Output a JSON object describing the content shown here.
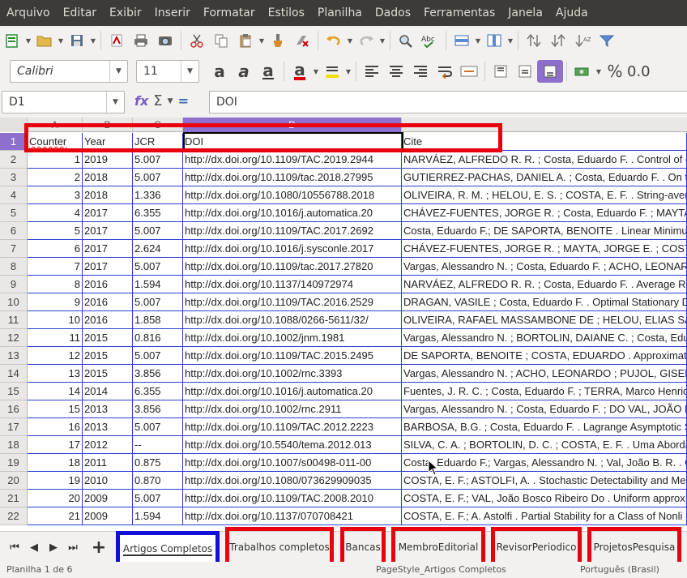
{
  "menubar": [
    "Arquivo",
    "Editar",
    "Exibir",
    "Inserir",
    "Formatar",
    "Estilos",
    "Planilha",
    "Dados",
    "Ferramentas",
    "Janela",
    "Ajuda"
  ],
  "toolbar": {
    "font_name": "Calibri",
    "font_size": "11",
    "percent_label": "%",
    "number_label": "0.0"
  },
  "formula_bar": {
    "name_box": "D1",
    "content": "DOI",
    "sum_icon": "Σ",
    "eq_icon": "="
  },
  "columns": [
    "A",
    "B",
    "C",
    "D"
  ],
  "header_row": {
    "num": "1",
    "a": "Counter",
    "b": "Year",
    "c": "JCR",
    "d": "DOI",
    "e": "Cite"
  },
  "rows": [
    {
      "num": "2",
      "a": "1",
      "b": "2019",
      "c": "5.007",
      "d": "http://dx.doi.org/10.1109/TAC.2019.2944",
      "e": "NARVÁEZ, ALFREDO R. R. ; Costa, Eduardo F. . Control of co"
    },
    {
      "num": "3",
      "a": "2",
      "b": "2018",
      "c": "5.007",
      "d": "http://dx.doi.org/10.1109/tac.2018.27995",
      "e": "GUTIERREZ-PACHAS, DANIEL A. ; Costa, Eduardo F. . On th"
    },
    {
      "num": "4",
      "a": "3",
      "b": "2018",
      "c": "1.336",
      "d": "http://dx.doi.org/10.1080/10556788.2018",
      "e": "OLIVEIRA, R. M. ; HELOU, E. S. ; COSTA, E. F. . String-average"
    },
    {
      "num": "5",
      "a": "4",
      "b": "2017",
      "c": "6.355",
      "d": "http://dx.doi.org/10.1016/j.automatica.20",
      "e": "CHÁVEZ-FUENTES, JORGE R. ; Costa, Eduardo F. ; MAYTA, J"
    },
    {
      "num": "6",
      "a": "5",
      "b": "2017",
      "c": "5.007",
      "d": "http://dx.doi.org/10.1109/TAC.2017.2692",
      "e": "Costa, Eduardo F.; DE SAPORTA, BENOITE . Linear Minimum"
    },
    {
      "num": "7",
      "a": "6",
      "b": "2017",
      "c": "2.624",
      "d": "http://dx.doi.org/10.1016/j.sysconle.2017",
      "e": "CHÁVEZ-FUENTES, JORGE R. ; MAYTA, JORGE E. ; COSTA, Ed"
    },
    {
      "num": "8",
      "a": "7",
      "b": "2017",
      "c": "5.007",
      "d": "http://dx.doi.org/10.1109/tac.2017.27820",
      "e": "Vargas, Alessandro N. ; Costa, Eduardo F. ; ACHO, LEONAR"
    },
    {
      "num": "9",
      "a": "8",
      "b": "2016",
      "c": "1.594",
      "d": "http://dx.doi.org/10.1137/140972974",
      "e": "NARVÁEZ, ALFREDO R. R. ; Costa, Eduardo F. . Average Rea"
    },
    {
      "num": "10",
      "a": "9",
      "b": "2016",
      "c": "5.007",
      "d": "http://dx.doi.org/10.1109/TAC.2016.2529",
      "e": "DRAGAN, VASILE ; Costa, Eduardo F. . Optimal Stationary D"
    },
    {
      "num": "11",
      "a": "10",
      "b": "2016",
      "c": "1.858",
      "d": "http://dx.doi.org/10.1088/0266-5611/32/",
      "e": "OLIVEIRA, RAFAEL MASSAMBONE DE ; HELOU, ELIAS SALO"
    },
    {
      "num": "12",
      "a": "11",
      "b": "2015",
      "c": "0.816",
      "d": "http://dx.doi.org/10.1002/jnm.1981",
      "e": "Vargas, Alessandro N. ; BORTOLIN, DAIANE C. ; Costa, Edu"
    },
    {
      "num": "13",
      "a": "12",
      "b": "2015",
      "c": "5.007",
      "d": "http://dx.doi.org/10.1109/TAC.2015.2495",
      "e": "DE SAPORTA, BENOITE ; COSTA, EDUARDO . Approximate K"
    },
    {
      "num": "14",
      "a": "13",
      "b": "2015",
      "c": "3.856",
      "d": "http://dx.doi.org/10.1002/rnc.3393",
      "e": "Vargas, Alessandro N. ; ACHO, LEONARDO ; PUJOL, GISELA"
    },
    {
      "num": "15",
      "a": "14",
      "b": "2014",
      "c": "6.355",
      "d": "http://dx.doi.org/10.1016/j.automatica.20",
      "e": "Fuentes, J. R. C. ; Costa, Eduardo F. ; TERRA, Marco Henriqu"
    },
    {
      "num": "16",
      "a": "15",
      "b": "2013",
      "c": "3.856",
      "d": "http://dx.doi.org/10.1002/rnc.2911",
      "e": "Vargas, Alessandro N. ; Costa, Eduardo F. ; DO VAL, JOÃO B"
    },
    {
      "num": "17",
      "a": "16",
      "b": "2013",
      "c": "5.007",
      "d": "http://dx.doi.org/10.1109/TAC.2012.2223",
      "e": "BARBOSA, B.G. ; Costa, Eduardo F. . Lagrange Asymptotic S"
    },
    {
      "num": "18",
      "a": "17",
      "b": "2012",
      "c": "--",
      "d": "http://dx.doi.org/10.5540/tema.2012.013",
      "e": "SILVA, C. A. ; BORTOLIN, D. C. ; COSTA, E. F. . Uma Aborda"
    },
    {
      "num": "19",
      "a": "18",
      "b": "2011",
      "c": "0.875",
      "d": "http://dx.doi.org/10.1007/s00498-011-00",
      "e": "Costa, Eduardo F.; Vargas, Alessandro N. ; Val, João B. R. . G"
    },
    {
      "num": "20",
      "a": "19",
      "b": "2010",
      "c": "0.870",
      "d": "http://dx.doi.org/10.1080/073629909035",
      "e": "COSTA, E. F.; ASTOLFI, A. . Stochastic Detectability and Me"
    },
    {
      "num": "21",
      "a": "20",
      "b": "2009",
      "c": "5.007",
      "d": "http://dx.doi.org/10.1109/TAC.2008.2010",
      "e": "COSTA, E. F.; VAL, João Bosco Ribeiro Do . Uniform approx"
    },
    {
      "num": "22",
      "a": "21",
      "b": "2009",
      "c": "1.594",
      "d": "http://dx.doi.org/10.1137/070708421",
      "e": "COSTA, E. F.; A. Astolfi . Partial Stability for a Class of Nonli"
    }
  ],
  "sheet_tabs": [
    "Artigos Completos",
    "Trabalhos completos",
    "Bancas",
    "MembroEditorial",
    "RevisorPeriodico",
    "ProjetosPesquisa"
  ],
  "active_tab": "Artigos Completos",
  "status": {
    "sheet": "Planilha 1 de 6",
    "page_style": "PageStyle_Artigos Completos",
    "language": "Português (Brasil)"
  }
}
